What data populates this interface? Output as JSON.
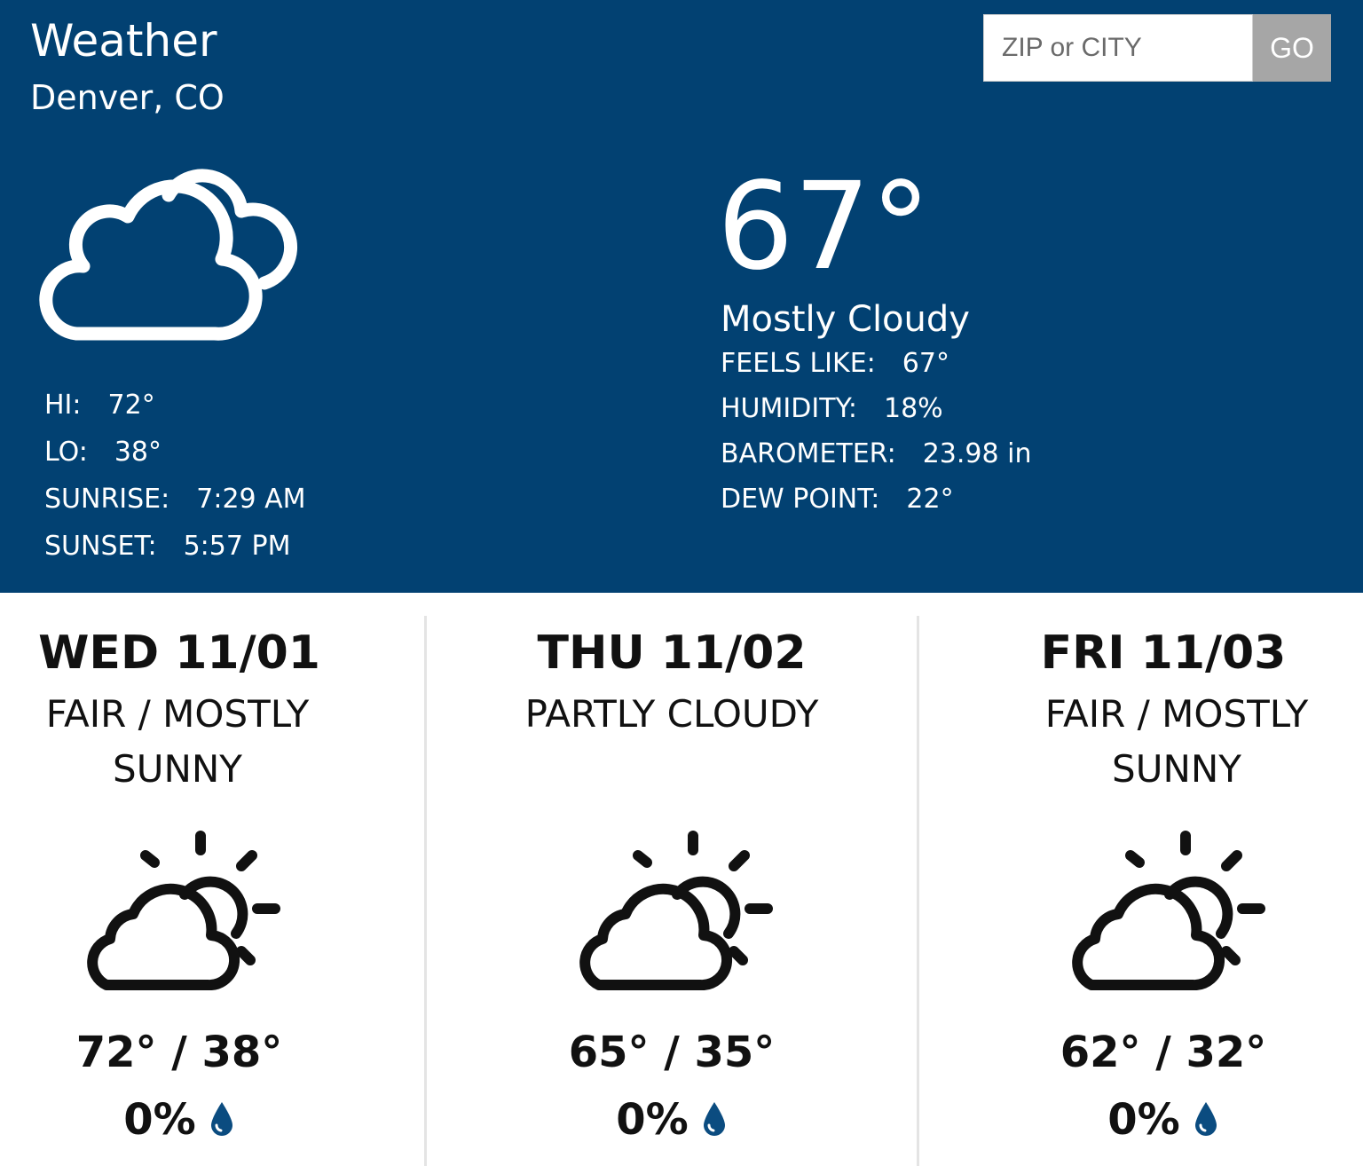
{
  "header": {
    "title": "Weather",
    "location": "Denver, CO",
    "search": {
      "placeholder": "ZIP or CITY",
      "button_label": "GO"
    },
    "current": {
      "icon": "mostly-cloudy-icon",
      "temperature": "67°",
      "condition": "Mostly Cloudy",
      "left_stats": [
        {
          "label": "HI:",
          "value": "72°"
        },
        {
          "label": "LO:",
          "value": "38°"
        },
        {
          "label": "SUNRISE:",
          "value": "7:29 AM"
        },
        {
          "label": "SUNSET:",
          "value": "5:57 PM"
        }
      ],
      "right_stats": [
        {
          "label": "FEELS LIKE:",
          "value": "67°"
        },
        {
          "label": "HUMIDITY:",
          "value": "18%"
        },
        {
          "label": "BAROMETER:",
          "value": "23.98 in"
        },
        {
          "label": "DEW POINT:",
          "value": "22°"
        }
      ]
    }
  },
  "forecast": [
    {
      "day": "WED 11/01",
      "condition": "FAIR / MOSTLY SUNNY",
      "icon": "partly-sunny-icon",
      "temps": "72° / 38°",
      "precip": "0%"
    },
    {
      "day": "THU 11/02",
      "condition": "PARTLY CLOUDY",
      "icon": "partly-sunny-icon",
      "temps": "65° / 35°",
      "precip": "0%"
    },
    {
      "day": "FRI 11/03",
      "condition": "FAIR / MOSTLY SUNNY",
      "icon": "partly-sunny-icon",
      "temps": "62° / 32°",
      "precip": "0%"
    }
  ],
  "colors": {
    "header_bg": "#024172",
    "drop": "#0b4c80",
    "go_button": "#a6a6a6"
  }
}
